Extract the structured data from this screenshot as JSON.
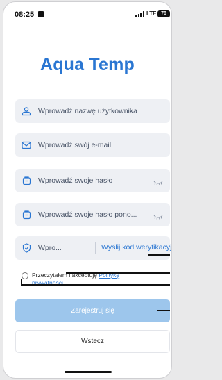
{
  "status_bar": {
    "time": "08:25",
    "network": "LTE",
    "battery": "78"
  },
  "brand": {
    "title": "Aqua Temp"
  },
  "form": {
    "username_placeholder": "Wprowadź nazwę użytkownika",
    "email_placeholder": "Wprowadź swój e-mail",
    "password_placeholder": "Wprowadź swoje hasło",
    "password_repeat_placeholder": "Wprowadź swoje hasło pono...",
    "code_placeholder": "Wpro...",
    "send_code_label": "Wyślij kod weryfikacyjny"
  },
  "agreement": {
    "text": "Przeczytałem i akceptuję ",
    "link": "Politykę prywatności"
  },
  "actions": {
    "register_label": "Zarejestruj się",
    "back_label": "Wstecz"
  },
  "colors": {
    "brand": "#2a76d2",
    "primary_disabled": "#9dc6ec",
    "field_bg": "#eef0f4"
  }
}
